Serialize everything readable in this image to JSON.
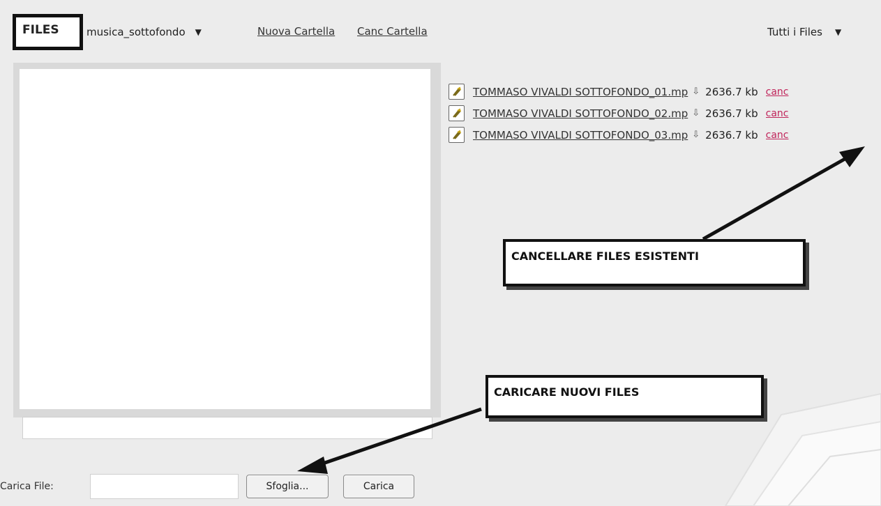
{
  "toolbar": {
    "files_label": "FILES",
    "folder_selected": "musica_sottofondo",
    "new_folder_link": "Nuova Cartella",
    "delete_folder_link": "Canc Cartella",
    "filter_selected": "Tutti i Files"
  },
  "files": [
    {
      "name": "TOMMASO VIVALDI SOTTOFONDO_01.mp",
      "size": "2636.7 kb",
      "delete_label": "canc"
    },
    {
      "name": "TOMMASO VIVALDI SOTTOFONDO_02.mp",
      "size": "2636.7 kb",
      "delete_label": "canc"
    },
    {
      "name": "TOMMASO VIVALDI SOTTOFONDO_03.mp",
      "size": "2636.7 kb",
      "delete_label": "canc"
    }
  ],
  "annotations": {
    "delete_callout": "CANCELLARE FILES ESISTENTI",
    "upload_callout": "CARICARE NUOVI FILES"
  },
  "upload": {
    "label": "Carica File:",
    "input_value": "",
    "browse_button": "Sfoglia...",
    "upload_button": "Carica"
  },
  "colors": {
    "background": "#ececec",
    "delete_link": "#c0245a",
    "callout_border": "#111111"
  },
  "icons": {
    "file": "audio-file-icon",
    "download": "download-arrow-icon",
    "dropdown": "chevron-down-icon"
  }
}
